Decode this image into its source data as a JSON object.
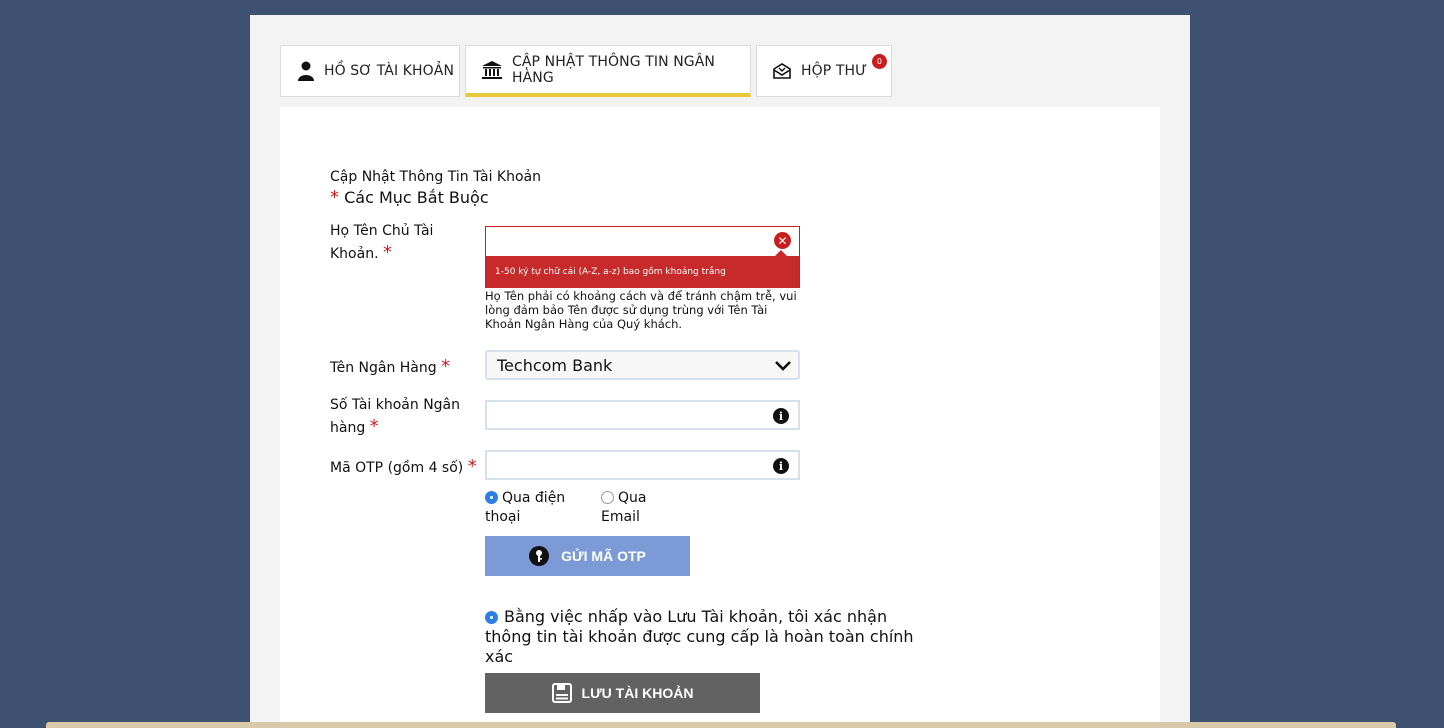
{
  "tabs": [
    {
      "label": "HỒ SƠ TÀI KHOẢN",
      "icon": "user-icon"
    },
    {
      "label": "CẬP NHẬT THÔNG TIN NGÂN HÀNG",
      "icon": "bank-icon",
      "active": true
    },
    {
      "label": "HỘP THƯ",
      "icon": "mail-icon",
      "badge": "0"
    }
  ],
  "form": {
    "title": "Cập Nhật Thông Tin Tài Khoản",
    "required_star": "*",
    "required_note": "Các Mục Bắt Buộc",
    "name": {
      "label": "Họ Tên Chủ Tài Khoản.",
      "value": "",
      "error": "1-50 ký tự chữ cái (A-Z, a-z) bao gồm khoảng trắng",
      "hint": "Họ Tên phải có khoảng cách và để tránh chậm trễ, vui lòng đảm bảo Tên được sử dụng trùng với Tên Tài Khoản Ngân Hàng của Quý khách."
    },
    "bank": {
      "label": "Tên Ngân Hàng",
      "selected": "Techcom Bank"
    },
    "account_number": {
      "label": "Số Tài khoản Ngân hàng",
      "value": ""
    },
    "otp": {
      "label": "Mã OTP (gồm 4 số)",
      "value": "",
      "option_phone": "Qua điện thoại",
      "option_email": "Qua Email",
      "selected": "phone",
      "send_button": "GỬI MÃ OTP"
    },
    "confirm_text": "Bằng việc nhấp vào Lưu Tài khoản, tôi xác nhận thông tin tài khoản được cung cấp là hoàn toàn chính xác",
    "save_button": "LƯU TÀI KHOẢN"
  },
  "colors": {
    "background": "#3e5170",
    "active_tab_underline": "#e8c93a",
    "error": "#c62a2a",
    "otp_button": "#7b9ad6",
    "save_button": "#626262"
  }
}
